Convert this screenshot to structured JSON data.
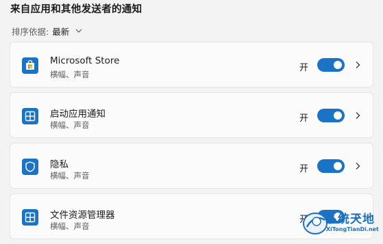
{
  "section": {
    "title": "来自应用和其他发送者的通知"
  },
  "sort": {
    "label": "排序依据:",
    "value": "最新"
  },
  "apps": [
    {
      "name": "Microsoft Store",
      "subtitle": "横幅、声音",
      "toggle_label": "开",
      "toggle_on": true,
      "icon": "store-bag-icon"
    },
    {
      "name": "启动应用通知",
      "subtitle": "横幅、声音",
      "toggle_label": "开",
      "toggle_on": true,
      "icon": "app-window-icon"
    },
    {
      "name": "隐私",
      "subtitle": "横幅、声音",
      "toggle_label": "开",
      "toggle_on": true,
      "icon": "shield-icon"
    },
    {
      "name": "文件资源管理器",
      "subtitle": "横幅、声音",
      "toggle_label": "开",
      "toggle_on": true,
      "icon": "app-window-icon"
    }
  ],
  "watermark": {
    "text": "系统天地",
    "sub": "XiTongTianDi.net"
  },
  "colors": {
    "accent": "#1a73c7",
    "background": "#f3f3f3",
    "card": "#fbfbfb",
    "watermark": "#1d6fc0"
  }
}
